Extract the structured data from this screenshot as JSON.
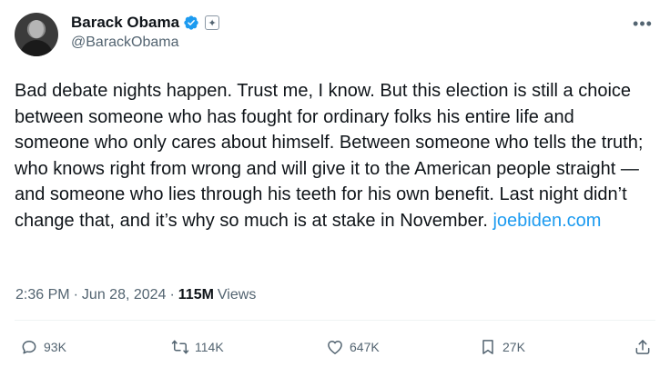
{
  "author": {
    "display_name": "Barack Obama",
    "handle": "@BarackObama"
  },
  "tweet": {
    "text": "Bad debate nights happen. Trust me, I know. But this election is still a choice between someone who has fought for ordinary folks his entire life and someone who only cares about himself. Between someone who tells the truth; who knows right from wrong and will give it to the American people straight — and someone who lies through his teeth for his own benefit. Last night didn’t change that, and it’s why so much is at stake in November.",
    "link_text": "joebiden.com",
    "time": "2:36 PM",
    "separator": "·",
    "date": "Jun 28, 2024",
    "views_count": "115M",
    "views_label": "Views"
  },
  "actions": {
    "replies": "93K",
    "reposts": "114K",
    "likes": "647K",
    "bookmarks": "27K"
  },
  "icons": {
    "verified": "verified-badge-icon",
    "government": "government-seal-icon",
    "more": "more-options-icon",
    "reply": "reply-icon",
    "repost": "repost-icon",
    "like": "like-icon",
    "bookmark": "bookmark-icon",
    "share": "share-icon"
  },
  "colors": {
    "accent": "#1d9bf0",
    "muted": "#536471",
    "text": "#0f1419"
  }
}
